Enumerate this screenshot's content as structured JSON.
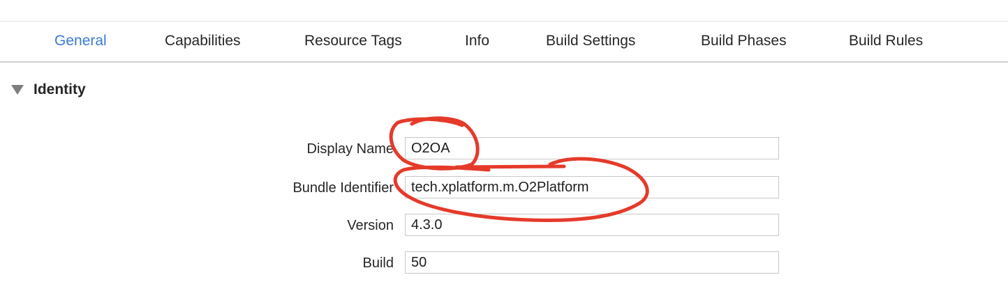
{
  "tabs": [
    {
      "label": "General",
      "active": true
    },
    {
      "label": "Capabilities",
      "active": false
    },
    {
      "label": "Resource Tags",
      "active": false
    },
    {
      "label": "Info",
      "active": false
    },
    {
      "label": "Build Settings",
      "active": false
    },
    {
      "label": "Build Phases",
      "active": false
    },
    {
      "label": "Build Rules",
      "active": false
    }
  ],
  "identity": {
    "title": "Identity",
    "fields": {
      "display_name": {
        "label": "Display Name",
        "value": "O2OA"
      },
      "bundle_identifier": {
        "label": "Bundle Identifier",
        "value": "tech.xplatform.m.O2Platform"
      },
      "version": {
        "label": "Version",
        "value": "4.3.0"
      },
      "build": {
        "label": "Build",
        "value": "50"
      }
    }
  },
  "colors": {
    "accent": "#3a7bd5",
    "annotation": "#e53a2a"
  },
  "icons": {
    "disclosure": "disclosure-triangle-icon"
  }
}
